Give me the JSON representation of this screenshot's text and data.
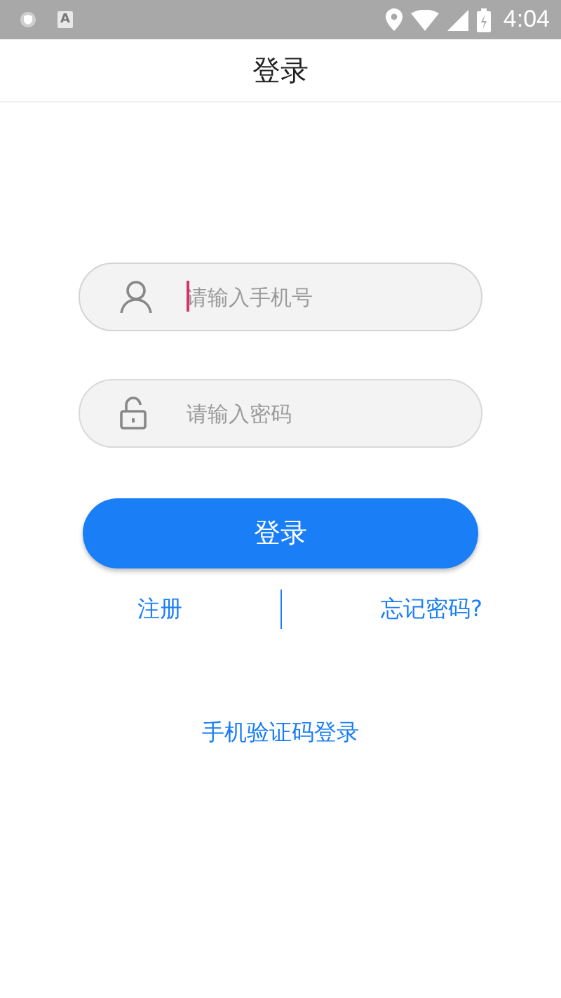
{
  "status_bar": {
    "notification_letter": "A",
    "time": "4:04"
  },
  "header": {
    "title": "登录"
  },
  "fields": [
    {
      "kind": "phone",
      "placeholder": "请输入手机号",
      "focused": true
    },
    {
      "kind": "password",
      "placeholder": "请输入密码",
      "focused": false
    }
  ],
  "login_button": "登录",
  "links": [
    {
      "label": "注册"
    },
    {
      "label": "忘记密码?"
    }
  ],
  "sms_login": "手机验证码登录"
}
